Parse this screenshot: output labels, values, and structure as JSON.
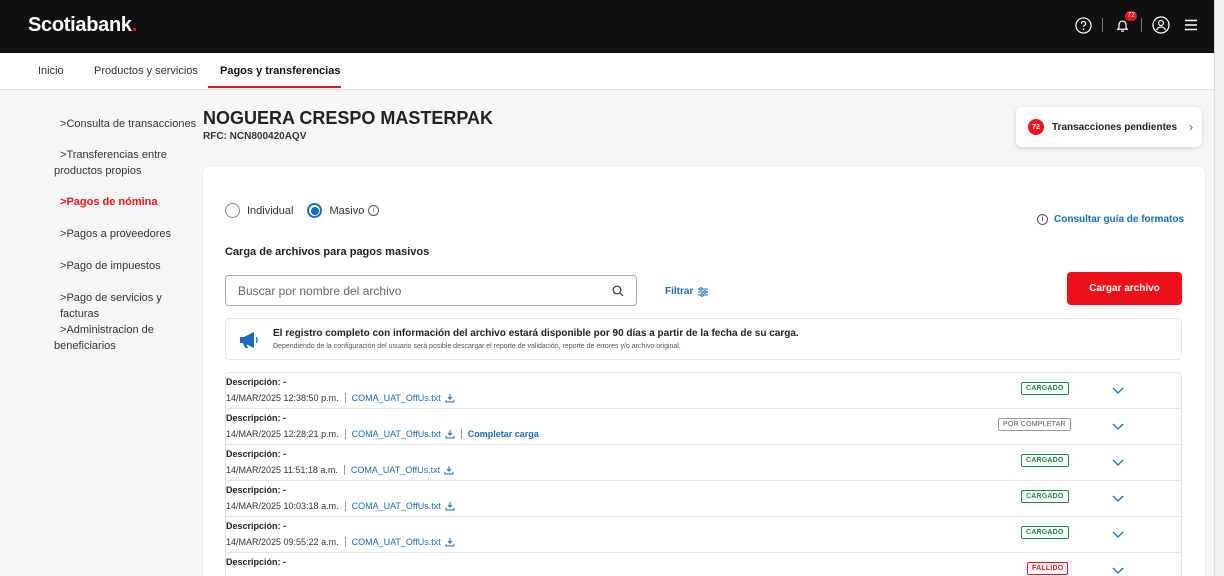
{
  "header": {
    "brand": "Scotiabank",
    "brand_dot": ".",
    "notification_count": "72"
  },
  "nav": {
    "items": [
      "Inicio",
      "Productos y servicios",
      "Pagos y transferencias"
    ],
    "active": "Pagos y transferencias"
  },
  "sidebar": {
    "items": [
      "Consulta de transacciones",
      "Transferencias entre",
      "productos propios",
      "Pagos de nómina",
      "Pagos a proveedores",
      "Pago de impuestos",
      "Pago de servicios y facturas",
      "Administracion de",
      "beneficiarios"
    ],
    "chevron": ">"
  },
  "company": {
    "name": "NOGUERA CRESPO MASTERPAK",
    "rfc": "RFC: NCN800420AQV"
  },
  "pending": {
    "count": "72",
    "label": "Transacciones pendientes",
    "chevron": "›"
  },
  "mode": {
    "individual": "Individual",
    "masivo": "Masivo",
    "selected": "Masivo",
    "info_glyph": "i"
  },
  "guide_link": "Consultar guía de formatos",
  "section_title": "Carga de archivos para pagos masivos",
  "search": {
    "placeholder": "Buscar por nombre del archivo"
  },
  "filter_label": "Filtrar",
  "upload_button": "Cargar archivo",
  "notice": {
    "title": "El registro completo con información del archivo estará disponible por 90 días a partir de la fecha de su carga.",
    "subtitle": "Dependiendo de la configuración del usuario será posible descargar el reporte de validación, reporte de errores y/o archivo original."
  },
  "records": [
    {
      "description": "Descripción: -",
      "datetime": "14/MAR/2025 12:38:50 p.m.",
      "file": "COMA_UAT_OffUs.txt",
      "action": "",
      "status": "CARGADO"
    },
    {
      "description": "Descripción: -",
      "datetime": "14/MAR/2025 12:28:21 p.m.",
      "file": "COMA_UAT_OffUs.txt",
      "action": "Completar carga",
      "status": "POR COMPLETAR"
    },
    {
      "description": "Descripción: -",
      "datetime": "14/MAR/2025 11:51:18 a.m.",
      "file": "COMA_UAT_OffUs.txt",
      "action": "",
      "status": "CARGADO"
    },
    {
      "description": "Descripción: -",
      "datetime": "14/MAR/2025 10:03:18 a.m.",
      "file": "COMA_UAT_OffUs.txt",
      "action": "",
      "status": "CARGADO"
    },
    {
      "description": "Descripción: -",
      "datetime": "14/MAR/2025 09:55:22 a.m.",
      "file": "COMA_UAT_OffUs.txt",
      "action": "",
      "status": "CARGADO"
    },
    {
      "description": "Descripción: -",
      "datetime": "",
      "file": "",
      "action": "",
      "status": "FALLIDO"
    }
  ],
  "colors": {
    "brand_red": "#ec111a",
    "link_blue": "#1a6bbd",
    "success_green": "#1f8a43",
    "header_black": "#101010"
  }
}
